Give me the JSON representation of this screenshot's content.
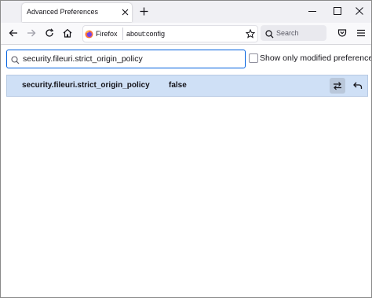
{
  "tab": {
    "title": "Advanced Preferences"
  },
  "toolbar": {
    "identity_label": "Firefox",
    "url": "about:config",
    "search_placeholder": "Search"
  },
  "config": {
    "filter_value": "security.fileuri.strict_origin_policy",
    "show_modified_label": "Show only modified preferences",
    "show_modified_checked": false,
    "preferences": [
      {
        "name": "security.fileuri.strict_origin_policy",
        "value": "false"
      }
    ]
  },
  "icons": {
    "close": "close-icon",
    "new_tab": "plus-icon",
    "minimize": "minimize-icon",
    "maximize": "maximize-icon",
    "window_close": "close-icon",
    "back": "back-arrow-icon",
    "forward": "forward-arrow-icon",
    "reload": "reload-icon",
    "home": "home-icon",
    "firefox": "firefox-logo-icon",
    "bookmark": "star-icon",
    "search": "search-icon",
    "pocket": "pocket-icon",
    "menu": "hamburger-menu-icon",
    "toggle": "toggle-arrows-icon",
    "reset": "undo-icon"
  },
  "colors": {
    "accent": "#0060df",
    "row_highlight": "#cfe0f6",
    "tabstrip": "#f0f0f4"
  }
}
